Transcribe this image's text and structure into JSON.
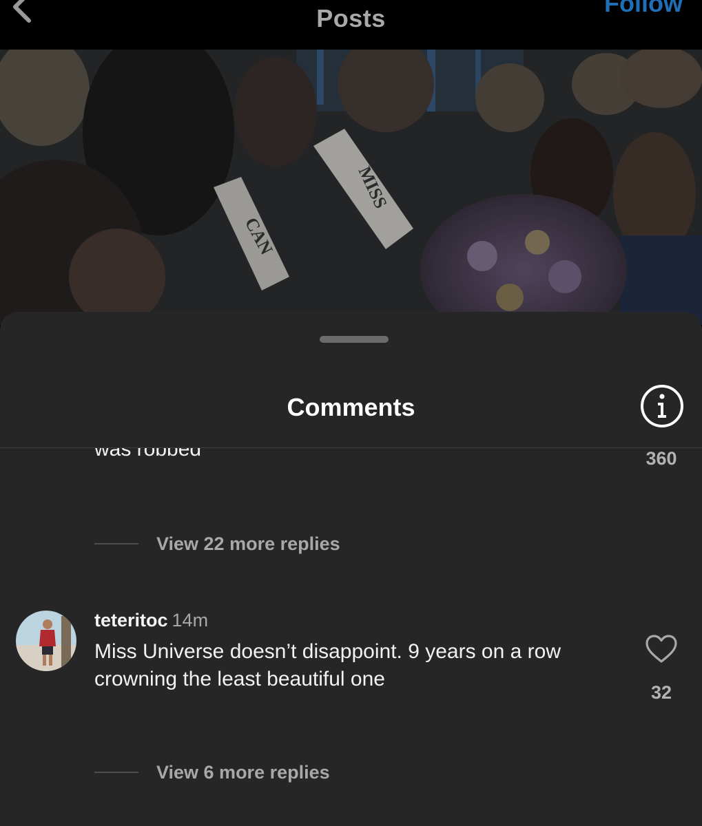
{
  "topbar": {
    "title": "Posts",
    "follow_label": "Follow",
    "back_icon": "chevron-left-icon"
  },
  "post": {
    "sash_text_1": "MISS",
    "sash_text_2": "CAN"
  },
  "comments_sheet": {
    "title": "Comments",
    "info_icon": "info-icon",
    "previous_comment": {
      "text_tail": "was robbed",
      "likes": "360",
      "replies_label": "View 22 more replies"
    },
    "comment": {
      "username": "teteritoc",
      "time": "14m",
      "text": "Miss Universe doesn’t disappoint. 9 years on a row crowning the least beautiful one",
      "likes": "32",
      "replies_label": "View 6 more replies"
    }
  },
  "colors": {
    "background": "#000000",
    "sheet": "#262626",
    "follow": "#1f6fb8",
    "muted_text": "#a8a8a8"
  }
}
